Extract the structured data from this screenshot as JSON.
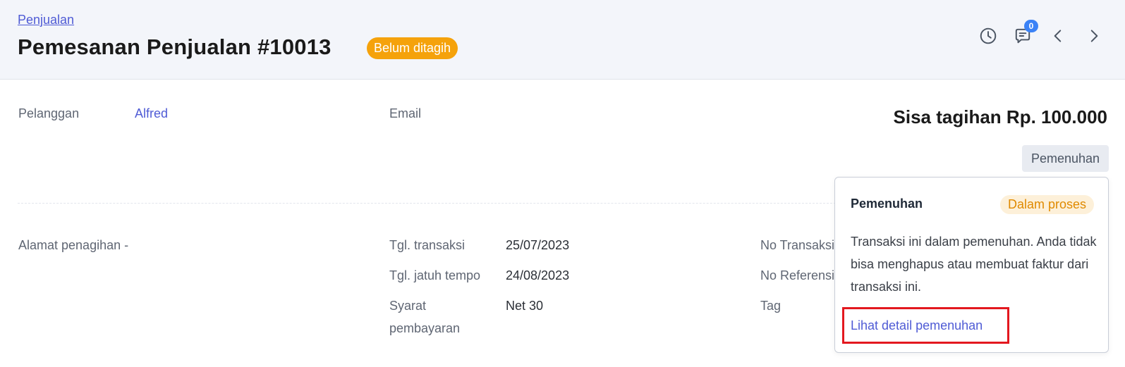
{
  "header": {
    "breadcrumb": "Penjualan",
    "title": "Pemesanan Penjualan #10013",
    "status_badge": "Belum ditagih",
    "comment_count": "0"
  },
  "icons": {
    "history": "clock-icon",
    "comments": "chat-icon",
    "previous": "chevron-left-icon",
    "next": "chevron-right-icon"
  },
  "customer": {
    "label": "Pelanggan",
    "value": "Alfred"
  },
  "email": {
    "label": "Email"
  },
  "balance": {
    "text": "Sisa tagihan Rp. 100.000"
  },
  "fulfillment_button": "Pemenuhan",
  "billing_address": {
    "label": "Alamat penagihan",
    "value": "-"
  },
  "details": {
    "transaction_date_label": "Tgl. transaksi",
    "transaction_date": "25/07/2023",
    "due_date_label": "Tgl. jatuh tempo",
    "due_date": "24/08/2023",
    "payment_terms_label_line1": "Syarat",
    "payment_terms_label_line2": "pembayaran",
    "payment_terms": "Net 30"
  },
  "right_column": {
    "transaction_no_label": "No Transaksi",
    "reference_no_label": "No Referensi",
    "tag_label": "Tag"
  },
  "popover": {
    "title": "Pemenuhan",
    "badge": "Dalam proses",
    "body": "Transaksi ini dalam pemenuhan. Anda tidak bisa menghapus atau membuat faktur dari transaksi ini.",
    "link": "Lihat detail pemenuhan"
  },
  "colors": {
    "accent": "#4f5bd5",
    "status_orange": "#f5a20b",
    "badge_blue": "#3b82f6",
    "highlight_red": "#e3181f"
  }
}
